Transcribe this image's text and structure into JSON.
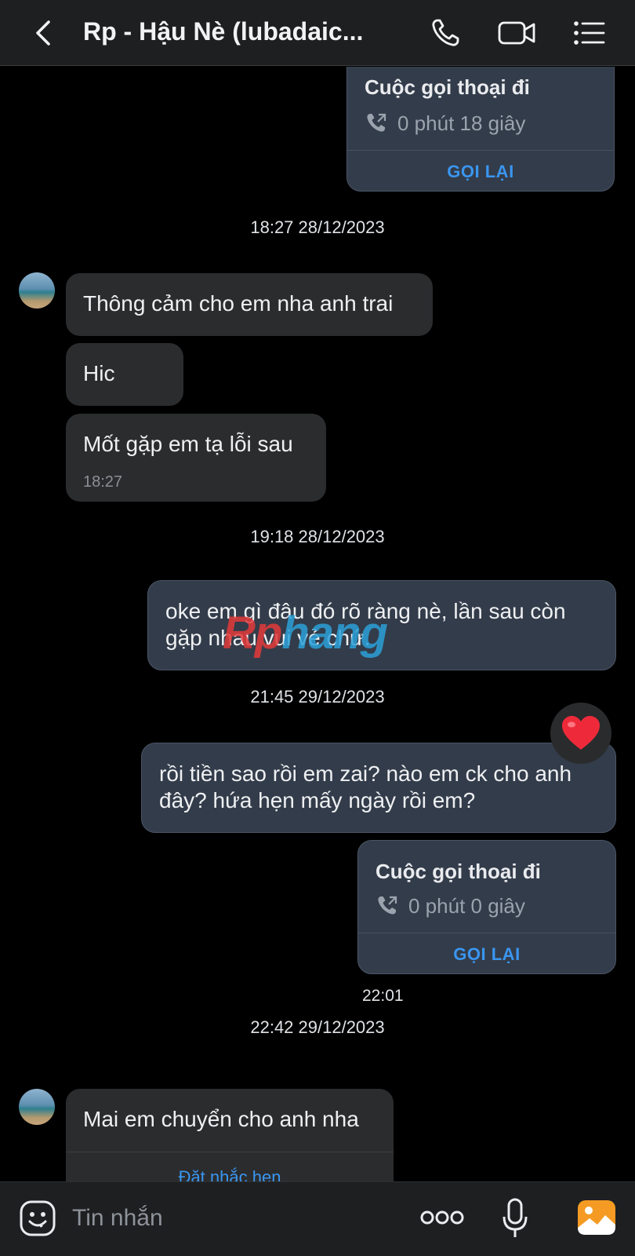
{
  "header": {
    "title": "Rp - Hậu Nè (lubadaic...",
    "back_icon": "chevron-left-icon",
    "call_icon": "phone-icon",
    "video_icon": "video-camera-icon",
    "menu_icon": "list-menu-icon"
  },
  "messages": {
    "call1": {
      "title": "Cuộc gọi thoại đi",
      "duration": "0 phút 18 giây",
      "action": "GỌI LẠI"
    },
    "ts1": "18:27 28/12/2023",
    "in1": "Thông cảm cho em nha anh trai",
    "in2": "Hic",
    "in3": "Mốt gặp em tạ lỗi sau",
    "in3_time": "18:27",
    "ts2": "19:18 28/12/2023",
    "out1": "oke em gì đâu đó rõ ràng nè, lần sau còn gặp nhau vui vẻ chứ.",
    "ts3": "21:45 29/12/2023",
    "out2": "rồi tiền sao rồi em zai? nào em ck cho anh đây? hứa hẹn mấy ngày rồi em?",
    "reaction": "❤️",
    "call2": {
      "title": "Cuộc gọi thoại đi",
      "duration": "0 phút 0 giây",
      "action": "GỌI LẠI",
      "time": "22:01"
    },
    "ts4": "22:42 29/12/2023",
    "in4": "Mai em chuyển cho anh nha",
    "reminder": "Đặt nhắc hẹn"
  },
  "watermark": {
    "part1": "Rp",
    "part2": "hang"
  },
  "composer": {
    "placeholder": "Tin nhắn",
    "emoji_icon": "emoji-icon",
    "more_icon": "more-dots-icon",
    "mic_icon": "microphone-icon",
    "image_icon": "image-icon"
  },
  "colors": {
    "header_bg": "#1e1f21",
    "incoming_bubble": "#2b2c2e",
    "outgoing_bubble": "#333c4a",
    "link_blue": "#3a96f0",
    "image_icon_orange": "#f59b23"
  }
}
